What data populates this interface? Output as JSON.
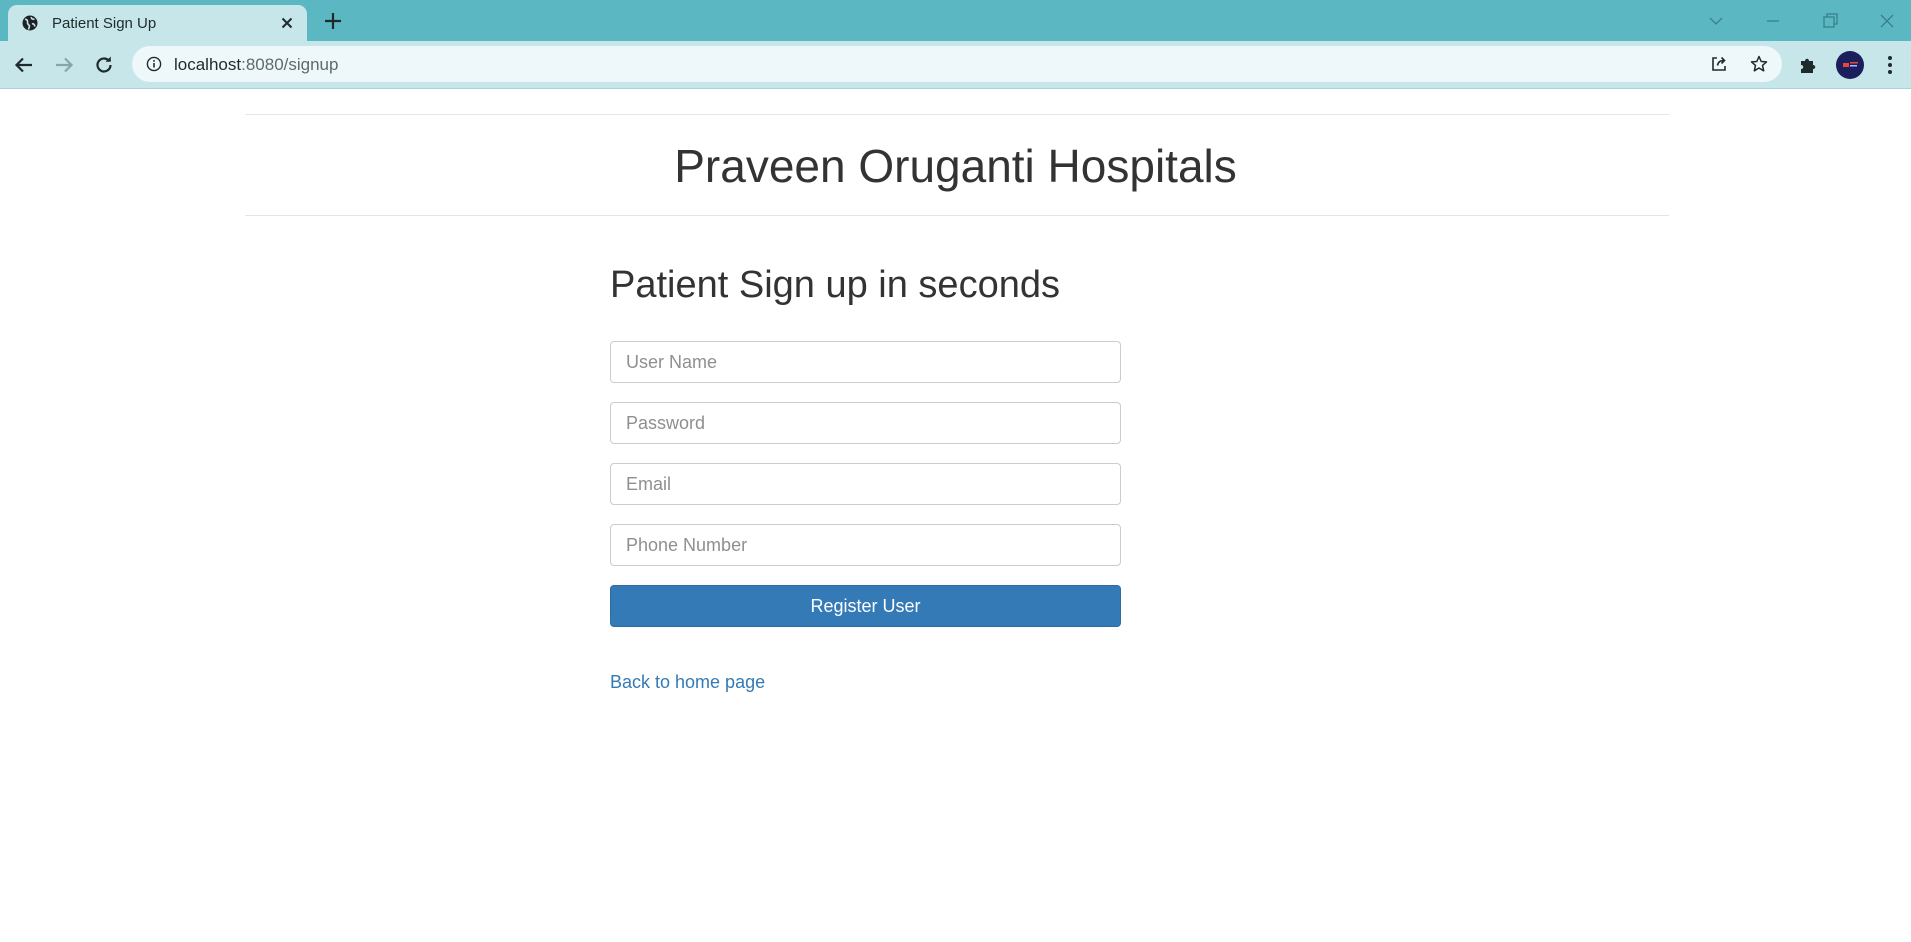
{
  "browser": {
    "tab": {
      "title": "Patient Sign Up"
    },
    "address_bar": {
      "host": "localhost",
      "rest": ":8080/signup"
    }
  },
  "colors": {
    "chrome_accent": "#5bb8c2",
    "chrome_toolbar": "#c6e6ea",
    "primary_button": "#337ab7",
    "link": "#337ab7"
  },
  "icons": {
    "tab_favicon": "globe-icon",
    "tab_close": "close-icon",
    "new_tab": "plus-icon",
    "back": "arrow-left-icon",
    "forward": "arrow-right-icon",
    "reload": "reload-icon",
    "site_info": "info-icon",
    "share": "share-icon",
    "bookmark": "star-icon",
    "extensions": "puzzle-icon",
    "menu": "kebab-menu-icon"
  },
  "header": {
    "title": "Praveen Oruganti Hospitals"
  },
  "signup_form": {
    "heading": "Patient Sign up in seconds",
    "username_placeholder": "User Name",
    "password_placeholder": "Password",
    "email_placeholder": "Email",
    "phone_placeholder": "Phone Number",
    "submit_label": "Register User"
  },
  "footer_link": {
    "label": "Back to home page"
  }
}
